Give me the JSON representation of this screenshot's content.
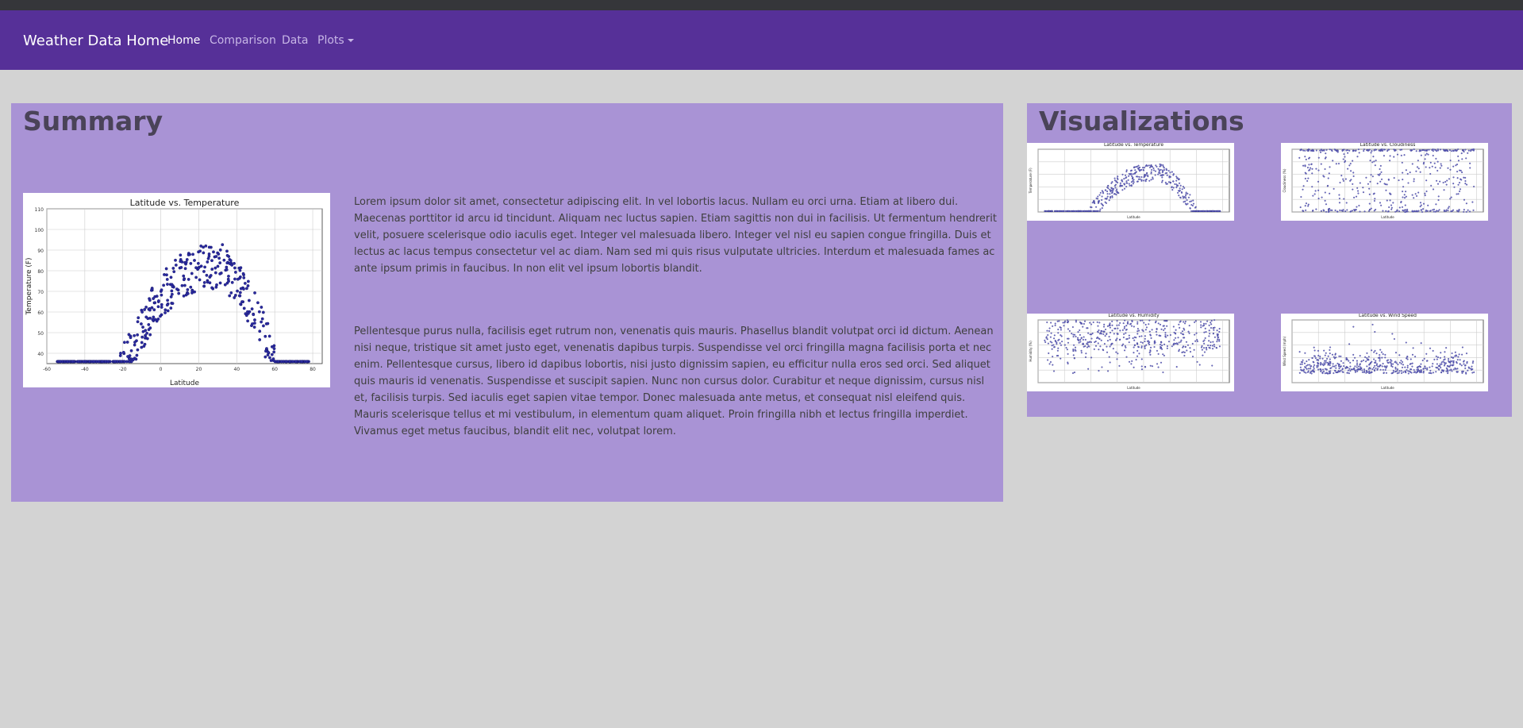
{
  "nav": {
    "brand": "Weather Data Home",
    "links": [
      {
        "label": "Home",
        "active": true
      },
      {
        "label": "Comparison",
        "active": false
      },
      {
        "label": "Data",
        "active": false
      },
      {
        "label": "Plots",
        "active": false,
        "dropdown": true
      }
    ]
  },
  "summary": {
    "heading": "Summary",
    "paragraphs": [
      "Lorem ipsum dolor sit amet, consectetur adipiscing elit. In vel lobortis lacus. Nullam eu orci urna. Etiam at libero dui. Maecenas porttitor id arcu id tincidunt. Aliquam nec luctus sapien. Etiam sagittis non dui in facilisis. Ut fermentum hendrerit velit, posuere scelerisque odio iaculis eget. Integer vel malesuada libero. Integer vel nisl eu sapien congue fringilla. Duis et lectus ac lacus tempus consectetur vel ac diam. Nam sed mi quis risus vulputate ultricies. Interdum et malesuada fames ac ante ipsum primis in faucibus. In non elit vel ipsum lobortis blandit.",
      "Pellentesque purus nulla, facilisis eget rutrum non, venenatis quis mauris. Phasellus blandit volutpat orci id dictum. Aenean nisi neque, tristique sit amet justo eget, venenatis dapibus turpis. Suspendisse vel orci fringilla magna facilisis porta et nec enim. Pellentesque cursus, libero id dapibus lobortis, nisi justo dignissim sapien, eu efficitur nulla eros sed orci. Sed aliquet quis mauris id venenatis. Suspendisse et suscipit sapien. Nunc non cursus dolor. Curabitur et neque dignissim, cursus nisl et, facilisis turpis. Sed iaculis eget sapien vitae tempor. Donec malesuada ante metus, et consequat nisl eleifend quis. Mauris scelerisque tellus et mi vestibulum, in elementum quam aliquet. Proin fringilla nibh et lectus fringilla imperdiet. Vivamus eget metus faucibus, blandit elit nec, volutpat lorem."
    ]
  },
  "visualizations": {
    "heading": "Visualizations"
  },
  "colors": {
    "navbar": "#563098",
    "panel": "#a993d5",
    "page_bg": "#d3d3d3",
    "points": "#1f1f8f"
  },
  "chart_data": [
    {
      "id": "main",
      "type": "scatter",
      "title": "Latitude vs. Temperature",
      "xlabel": "Latitude",
      "ylabel": "Temperature (F)",
      "xlim": [
        -60,
        85
      ],
      "ylim": [
        35,
        110
      ],
      "xticks": [
        -60,
        -40,
        -20,
        0,
        20,
        40,
        60,
        80
      ],
      "yticks": [
        40,
        50,
        60,
        70,
        80,
        90,
        100,
        110
      ],
      "shape": "temperature",
      "grid": true
    },
    {
      "id": "thumb-temp",
      "type": "scatter",
      "title": "Latitude vs. Temperature",
      "xlabel": "Latitude",
      "ylabel": "Temperature (F)",
      "xlim": [
        -60,
        85
      ],
      "ylim": [
        35,
        110
      ],
      "shape": "temperature",
      "grid": true
    },
    {
      "id": "thumb-cloud",
      "type": "scatter",
      "title": "Latitude vs. Cloudiness",
      "xlabel": "Latitude",
      "ylabel": "Cloudiness (%)",
      "xlim": [
        -60,
        85
      ],
      "ylim": [
        0,
        100
      ],
      "shape": "cloudiness",
      "grid": true
    },
    {
      "id": "thumb-hum",
      "type": "scatter",
      "title": "Latitude vs. Humidity",
      "xlabel": "Latitude",
      "ylabel": "Humidity (%)",
      "xlim": [
        -60,
        85
      ],
      "ylim": [
        0,
        100
      ],
      "shape": "humidity",
      "grid": true
    },
    {
      "id": "thumb-wind",
      "type": "scatter",
      "title": "Latitude vs. Wind Speed",
      "xlabel": "Latitude",
      "ylabel": "Wind Speed (mph)",
      "xlim": [
        -60,
        85
      ],
      "ylim": [
        0,
        35
      ],
      "shape": "wind",
      "grid": true
    }
  ]
}
